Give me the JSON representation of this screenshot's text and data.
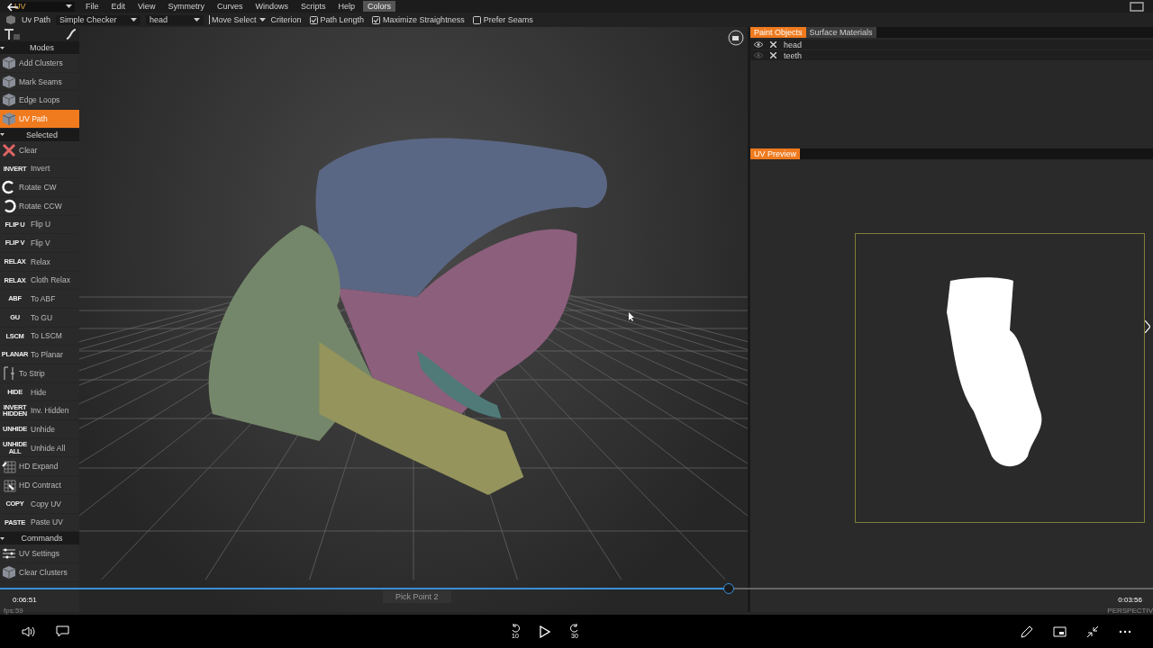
{
  "menubar": {
    "room": "UV",
    "menus": [
      {
        "label": "File",
        "selected": false
      },
      {
        "label": "Edit",
        "selected": false
      },
      {
        "label": "View",
        "selected": false
      },
      {
        "label": "Symmetry",
        "selected": false
      },
      {
        "label": "Curves",
        "selected": false
      },
      {
        "label": "Windows",
        "selected": false
      },
      {
        "label": "Scripts",
        "selected": false
      },
      {
        "label": "Help",
        "selected": false
      },
      {
        "label": "Colors",
        "selected": true
      }
    ]
  },
  "toolbar": {
    "tool": "Uv Path",
    "texture": "Simple Checker",
    "object": "head",
    "mode": "Move Select",
    "criterion": "Criterion",
    "options": [
      {
        "label": "Path Length",
        "checked": true
      },
      {
        "label": "Maximize Straightness",
        "checked": true
      },
      {
        "label": "Prefer Seams",
        "checked": false
      }
    ]
  },
  "sidebar": {
    "sections": [
      {
        "title": "Modes",
        "items": [
          {
            "label": "Add Clusters",
            "kind": "cube",
            "selected": false
          },
          {
            "label": "Mark Seams",
            "kind": "cube",
            "selected": false
          },
          {
            "label": "Edge Loops",
            "kind": "cube",
            "selected": false
          },
          {
            "label": "UV Path",
            "kind": "cube",
            "selected": true
          }
        ]
      },
      {
        "title": "Selected",
        "items": [
          {
            "label": "Clear",
            "kind": "cross"
          },
          {
            "label": "Invert",
            "kind": "badge",
            "badge": "INVERT"
          },
          {
            "label": "Rotate  CW",
            "kind": "rotate-cw"
          },
          {
            "label": "Rotate  CCW",
            "kind": "rotate-ccw"
          },
          {
            "label": "Flip  U",
            "kind": "badge",
            "badge": "FLIP U"
          },
          {
            "label": "Flip  V",
            "kind": "badge",
            "badge": "FLIP V"
          },
          {
            "label": "Relax",
            "kind": "badge",
            "badge": "RELAX"
          },
          {
            "label": "Cloth  Relax",
            "kind": "badge",
            "badge": "RELAX"
          },
          {
            "label": "To  ABF",
            "kind": "badge",
            "badge": "ABF"
          },
          {
            "label": "To  GU",
            "kind": "badge",
            "badge": "GU"
          },
          {
            "label": "To  LSCM",
            "kind": "badge",
            "badge": "LSCM"
          },
          {
            "label": "To  Planar",
            "kind": "badge",
            "badge": "PLANAR"
          },
          {
            "label": "To  Strip",
            "kind": "strip"
          },
          {
            "label": "Hide",
            "kind": "badge",
            "badge": "HIDE"
          },
          {
            "label": "Inv.  Hidden",
            "kind": "badge",
            "badge": "INVERT HIDDEN"
          },
          {
            "label": "Unhide",
            "kind": "badge",
            "badge": "UNHIDE"
          },
          {
            "label": "Unhide  All",
            "kind": "badge",
            "badge": "UNHIDE ALL"
          },
          {
            "label": "HD  Expand",
            "kind": "expand"
          },
          {
            "label": "HD  Contract",
            "kind": "contract"
          },
          {
            "label": "Copy  UV",
            "kind": "badge",
            "badge": "COPY"
          },
          {
            "label": "Paste  UV",
            "kind": "badge",
            "badge": "PASTE"
          }
        ]
      },
      {
        "title": "Commands",
        "items": [
          {
            "label": "UV  Settings",
            "kind": "sliders"
          },
          {
            "label": "Clear  Clusters",
            "kind": "cube"
          }
        ]
      }
    ]
  },
  "viewport": {
    "status": "Pick  Point  2",
    "fps": "fps:59",
    "projection": "PERSPECTIV"
  },
  "objects_panel": {
    "tabs": [
      {
        "label": "Paint  Objects",
        "selected": true
      },
      {
        "label": "Surface  Materials",
        "selected": false
      }
    ],
    "objects": [
      {
        "name": "head",
        "visible": true
      },
      {
        "name": "teeth",
        "visible": false
      }
    ]
  },
  "uv_preview": {
    "tab": "UV Preview"
  },
  "player": {
    "elapsed": "0:06:51",
    "remaining": "0:03:56",
    "level": 0.632,
    "rewind": "10",
    "forward": "30"
  }
}
